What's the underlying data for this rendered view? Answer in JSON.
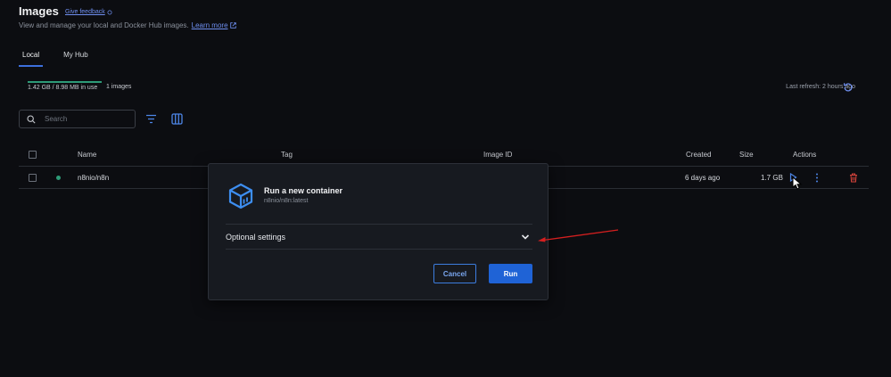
{
  "header": {
    "title": "Images",
    "feedback_link": "Give feedback",
    "subtitle": "View and manage your local and Docker Hub images.",
    "learn_more": "Learn more"
  },
  "tabs": [
    {
      "label": "Local",
      "active": true
    },
    {
      "label": "My Hub",
      "active": false
    }
  ],
  "usage": {
    "text": "1.42 GB / 8.98 MB in use",
    "count": "1 images"
  },
  "refresh": {
    "text": "Last refresh: 2 hours ago"
  },
  "search": {
    "placeholder": "Search"
  },
  "table": {
    "columns": [
      "Name",
      "Tag",
      "Image ID",
      "Created",
      "Size",
      "Actions"
    ],
    "rows": [
      {
        "name": "n8nio/n8n",
        "tag": "",
        "image_id": "",
        "created": "6 days ago",
        "size": "1.7 GB",
        "status": "in-use"
      }
    ]
  },
  "modal": {
    "title": "Run a new container",
    "subtitle": "n8nio/n8n:latest",
    "optional_settings": "Optional settings",
    "cancel_label": "Cancel",
    "run_label": "Run"
  },
  "colors": {
    "accent": "#1f63d6",
    "link": "#6f8ff0",
    "status_green": "#2e9b78",
    "danger": "#d9443c",
    "annotation_arrow": "#d41f1f"
  },
  "icons": [
    "external-link-icon",
    "search-icon",
    "filter-icon",
    "columns-icon",
    "refresh-icon",
    "play-icon",
    "more-vertical-icon",
    "trash-icon",
    "cube-icon",
    "chevron-down-icon",
    "cursor-icon"
  ]
}
